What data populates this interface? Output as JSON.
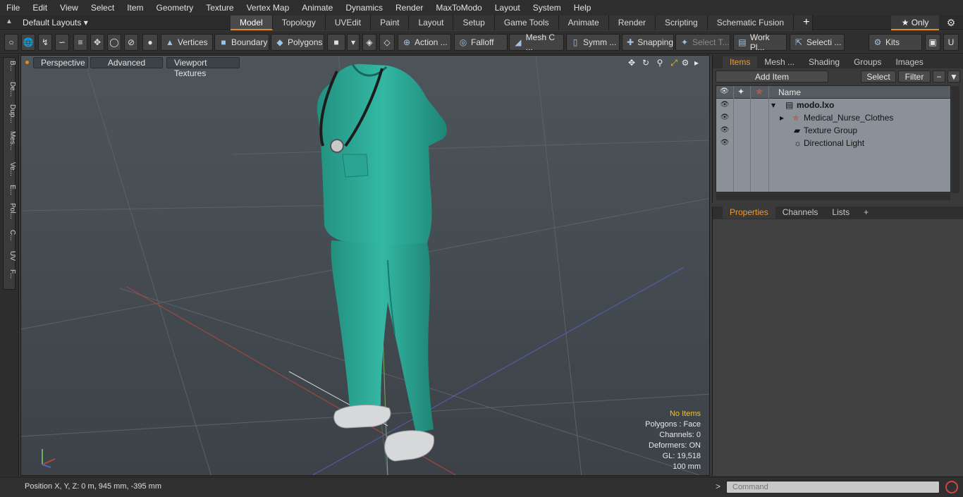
{
  "menu": [
    "File",
    "Edit",
    "View",
    "Select",
    "Item",
    "Geometry",
    "Texture",
    "Vertex Map",
    "Animate",
    "Dynamics",
    "Render",
    "MaxToModo",
    "Layout",
    "System",
    "Help"
  ],
  "layout": {
    "dropdown": "Default Layouts ▾",
    "tabs": [
      "Model",
      "Topology",
      "UVEdit",
      "Paint",
      "Layout",
      "Setup",
      "Game Tools",
      "Animate",
      "Render",
      "Scripting",
      "Schematic Fusion"
    ],
    "active_tab": "Model",
    "only_label": "★ Only"
  },
  "toolbar": {
    "vertices": "Vertices",
    "boundary": "Boundary",
    "polygons": "Polygons",
    "action": "Action ...",
    "falloff": "Falloff",
    "mesh": "Mesh C ...",
    "symm": "Symm ...",
    "snapping": "Snapping",
    "select_t": "Select T...",
    "work_pl": "Work Pl...",
    "selecti": "Selecti ...",
    "kits": "Kits"
  },
  "left_tabs": [
    "B...",
    "De...",
    "Dup...",
    "Mes...",
    "Ve...",
    "E...",
    "Pol...",
    "C...",
    "UV",
    "F..."
  ],
  "viewport": {
    "perspective": "Perspective",
    "advanced": "Advanced",
    "textures": "Viewport Textures",
    "stats": {
      "no_items": "No Items",
      "polygons": "Polygons : Face",
      "channels": "Channels: 0",
      "deformers": "Deformers: ON",
      "gl": "GL: 19,518",
      "scale": "100 mm"
    }
  },
  "items_panel": {
    "tabs": [
      "Items",
      "Mesh ...",
      "Shading",
      "Groups",
      "Images"
    ],
    "add_item": "Add Item",
    "select": "Select",
    "filter": "Filter",
    "name_header": "Name",
    "rows": [
      {
        "label": "modo.lxo",
        "bold": true
      },
      {
        "label": "Medical_Nurse_Clothes"
      },
      {
        "label": "Texture Group"
      },
      {
        "label": "Directional Light"
      }
    ]
  },
  "properties_panel": {
    "tabs": [
      "Properties",
      "Channels",
      "Lists"
    ]
  },
  "status": {
    "position": "Position X, Y, Z:   0 m, 945 mm, -395 mm"
  },
  "command": {
    "placeholder": "Command",
    "prompt": ">"
  },
  "colors": {
    "accent": "#e08a22",
    "scrubs": "#2fb3a0",
    "viewport_bg": "#4a5157"
  }
}
